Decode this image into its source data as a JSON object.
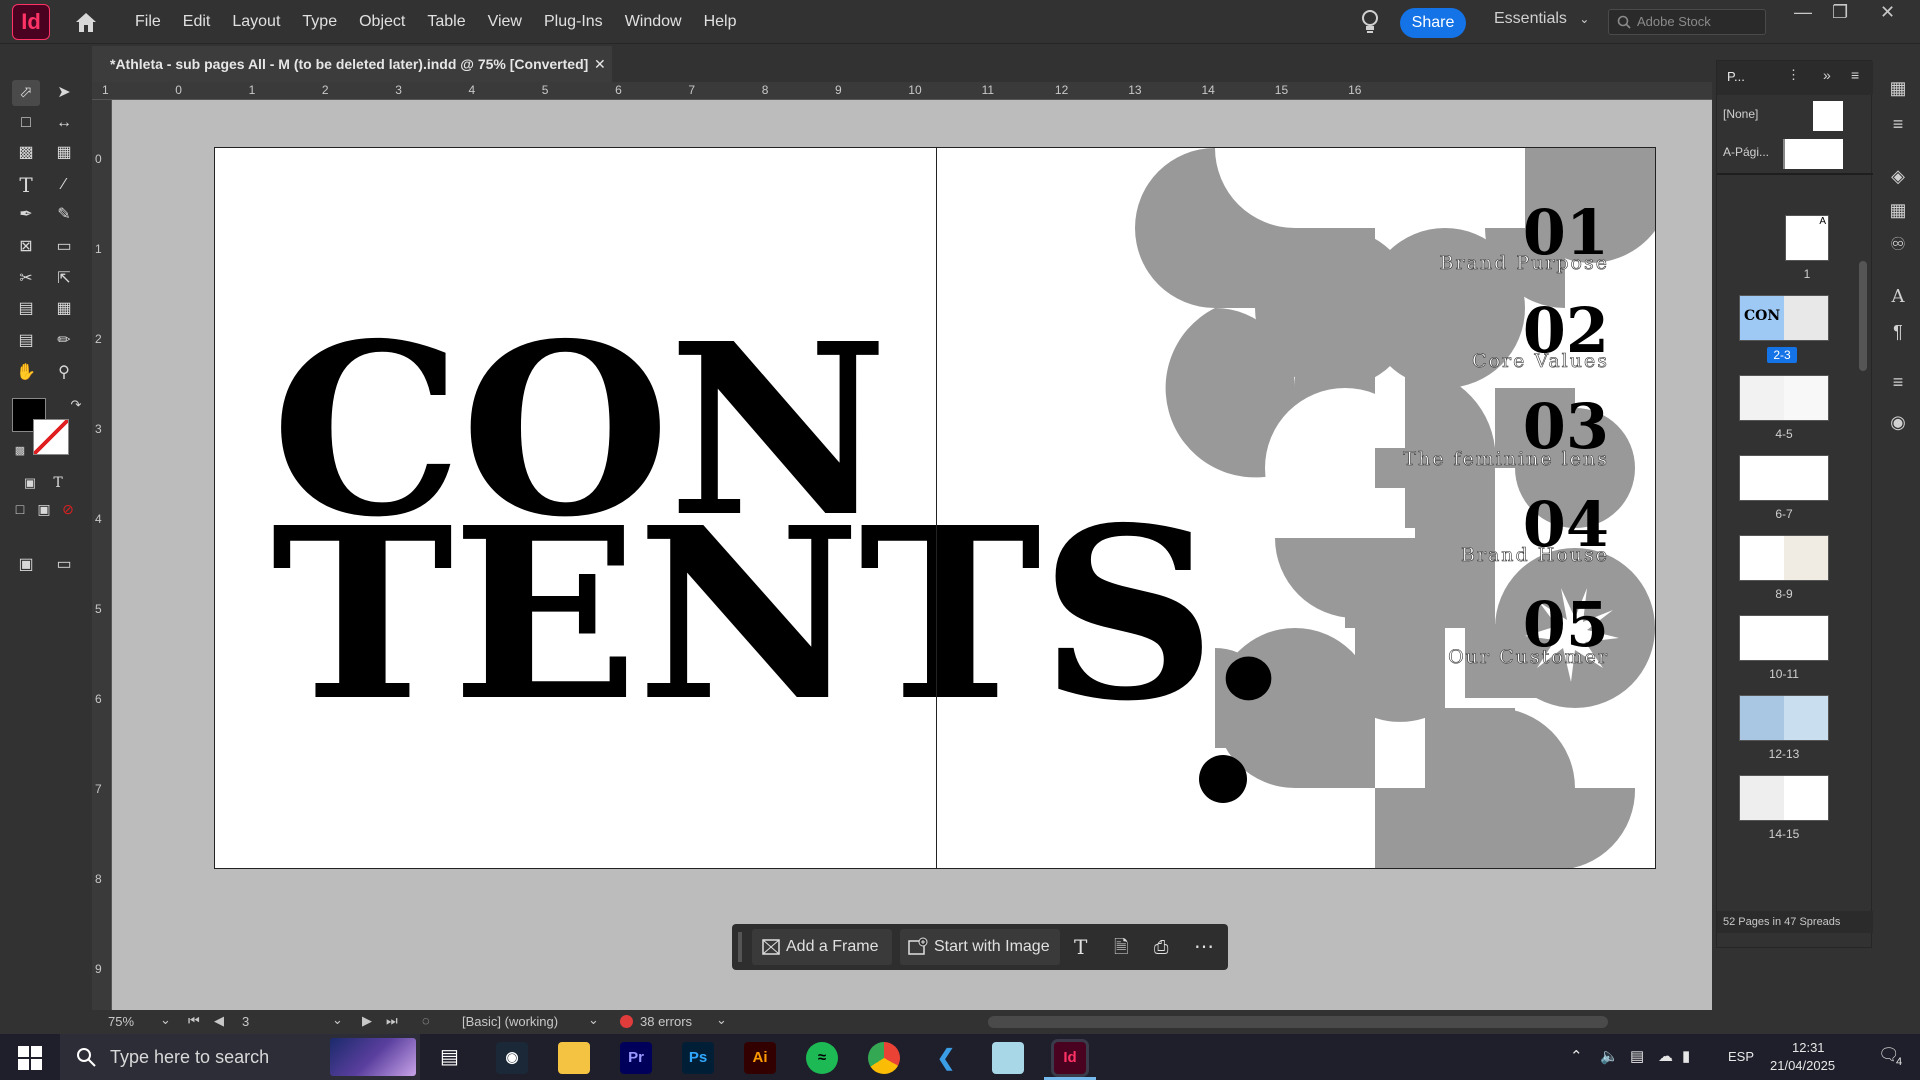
{
  "app": {
    "logo": "Id",
    "name": "Adobe InDesign"
  },
  "menu": [
    "File",
    "Edit",
    "Layout",
    "Type",
    "Object",
    "Table",
    "View",
    "Plug-Ins",
    "Window",
    "Help"
  ],
  "share_label": "Share",
  "workspace_label": "Essentials",
  "stock_search_placeholder": "Adobe Stock",
  "document_tab": "*Athleta - sub pages All - M (to be deleted later).indd @ 75% [Converted]",
  "ruler_h": [
    "1",
    "0",
    "1",
    "2",
    "3",
    "4",
    "5",
    "6",
    "7",
    "8",
    "9",
    "10",
    "11",
    "12",
    "13",
    "14",
    "15",
    "16"
  ],
  "ruler_v": [
    "0",
    "1",
    "2",
    "3",
    "4",
    "5",
    "6",
    "7",
    "8",
    "9"
  ],
  "spread": {
    "title_line1": "CON",
    "title_line2": "TENTS.",
    "toc": [
      {
        "num": "01",
        "label": "Brand Purpose"
      },
      {
        "num": "02",
        "label": "Core Values"
      },
      {
        "num": "03",
        "label": "The feminine lens"
      },
      {
        "num": "04",
        "label": "Brand House"
      },
      {
        "num": "05",
        "label": "Our Customer"
      }
    ],
    "shape_color": "#999999"
  },
  "pages_panel": {
    "tab_label": "P...",
    "masters": [
      {
        "label": "[None]"
      },
      {
        "label": "A-Pági..."
      }
    ],
    "spreads": [
      {
        "label": "1"
      },
      {
        "label": "2-3",
        "selected": true
      },
      {
        "label": "4-5"
      },
      {
        "label": "6-7"
      },
      {
        "label": "8-9"
      },
      {
        "label": "10-11"
      },
      {
        "label": "12-13"
      },
      {
        "label": "14-15"
      }
    ],
    "master_letter": "A",
    "footer": "52 Pages in 47 Spreads"
  },
  "context_bar": {
    "add_frame": "Add a Frame",
    "start_with_image": "Start with Image"
  },
  "status": {
    "zoom": "75%",
    "page": "3",
    "style": "[Basic] (working)",
    "errors": "38 errors"
  },
  "taskbar": {
    "search_placeholder": "Type here to search",
    "apps": [
      {
        "name": "steam",
        "label": ""
      },
      {
        "name": "file-explorer",
        "label": ""
      },
      {
        "name": "premiere",
        "label": "Pr"
      },
      {
        "name": "photoshop",
        "label": "Ps"
      },
      {
        "name": "illustrator",
        "label": "Ai"
      },
      {
        "name": "spotify",
        "label": ""
      },
      {
        "name": "chrome",
        "label": ""
      },
      {
        "name": "vscode",
        "label": ""
      },
      {
        "name": "generic",
        "label": ""
      },
      {
        "name": "indesign",
        "label": "Id"
      }
    ],
    "language": "ESP",
    "time": "12:31",
    "date": "21/04/2025",
    "notifications": "4"
  },
  "colors": {
    "accent": "#1473e6",
    "indesign_pink": "#ff3366",
    "error_red": "#e03c3c"
  }
}
